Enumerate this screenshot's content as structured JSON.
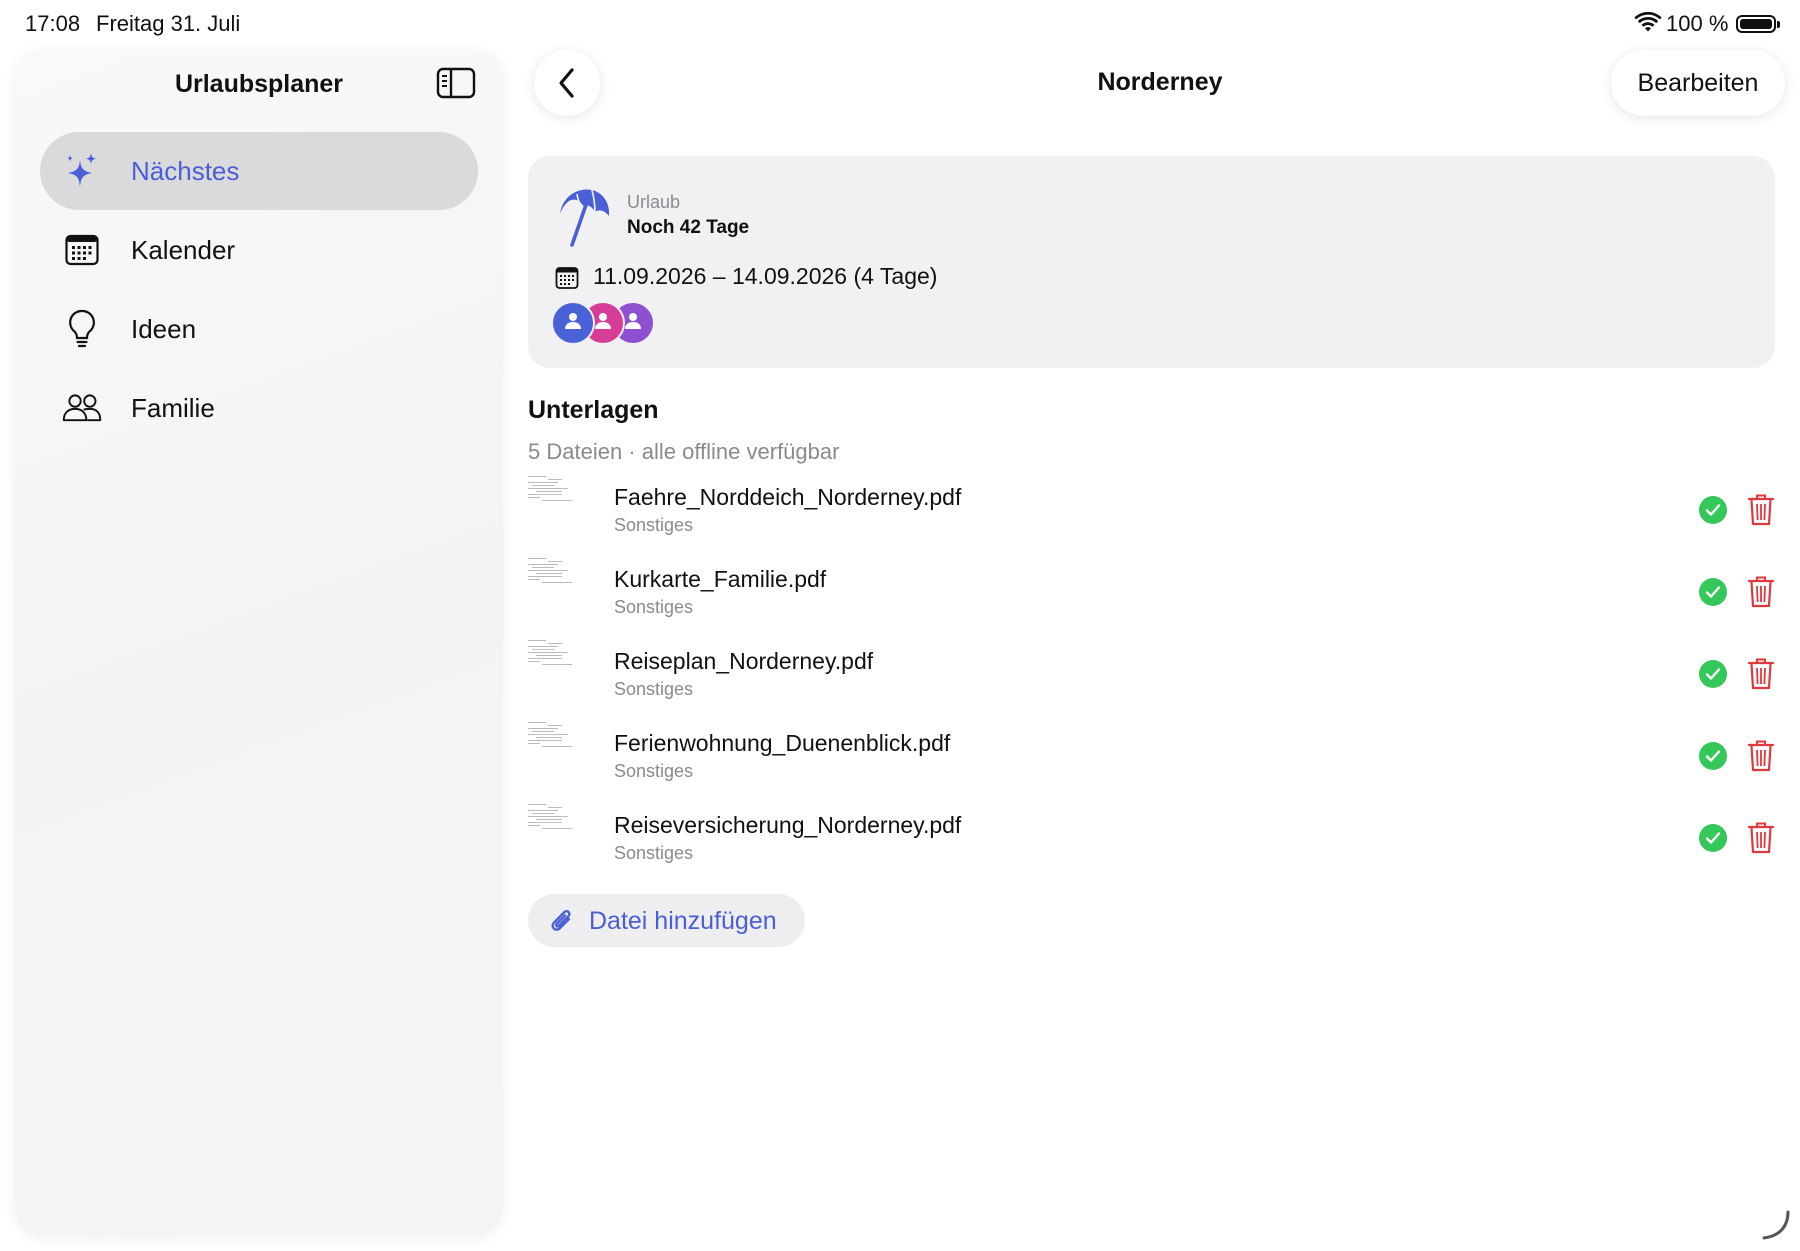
{
  "status_bar": {
    "time": "17:08",
    "date": "Freitag 31. Juli",
    "battery": "100 %"
  },
  "sidebar": {
    "title": "Urlaubsplaner",
    "items": [
      {
        "label": "Nächstes",
        "icon": "sparkles-icon",
        "active": true
      },
      {
        "label": "Kalender",
        "icon": "calendar-icon",
        "active": false
      },
      {
        "label": "Ideen",
        "icon": "lightbulb-icon",
        "active": false
      },
      {
        "label": "Familie",
        "icon": "people-icon",
        "active": false
      }
    ]
  },
  "header": {
    "title": "Norderney",
    "edit_label": "Bearbeiten"
  },
  "trip": {
    "kind": "Urlaub",
    "countdown": "Noch 42 Tage",
    "date_range": "11.09.2026 – 14.09.2026 (4 Tage)",
    "participant_colors": [
      "#4a62d8",
      "#d63d97",
      "#8e4fd1"
    ]
  },
  "documents": {
    "title": "Unterlagen",
    "subtitle": "5 Dateien · alle offline verfügbar",
    "files": [
      {
        "name": "Faehre_Norddeich_Norderney.pdf",
        "category": "Sonstiges"
      },
      {
        "name": "Kurkarte_Familie.pdf",
        "category": "Sonstiges"
      },
      {
        "name": "Reiseplan_Norderney.pdf",
        "category": "Sonstiges"
      },
      {
        "name": "Ferienwohnung_Duenenblick.pdf",
        "category": "Sonstiges"
      },
      {
        "name": "Reiseversicherung_Norderney.pdf",
        "category": "Sonstiges"
      }
    ],
    "add_label": "Datei hinzufügen"
  },
  "colors": {
    "accent": "#4a5fd6",
    "success": "#34c759",
    "danger": "#e0383e"
  }
}
